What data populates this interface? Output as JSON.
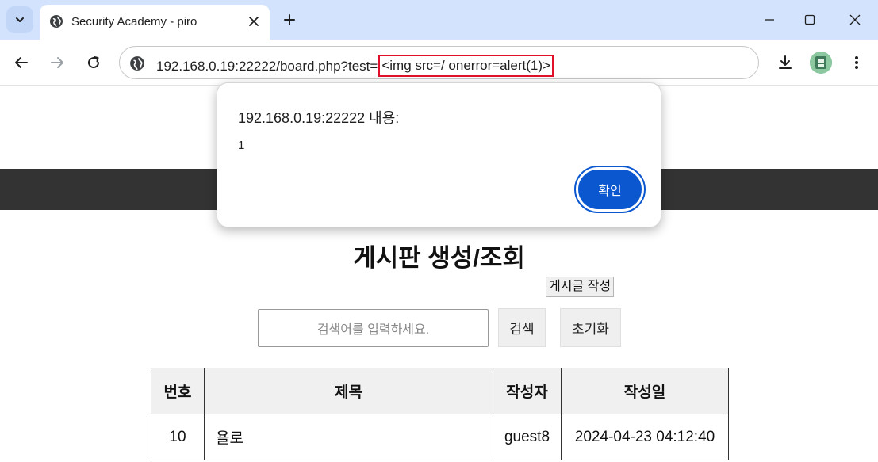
{
  "browser": {
    "tab_title": "Security Academy - piro",
    "url_prefix": "192.168.0.19:22222/board.php?test=",
    "url_highlighted": "<img src=/ onerror=alert(1)>",
    "colors": {
      "tabstrip": "#d3e3fd",
      "highlight_border": "#e0102a"
    }
  },
  "dialog": {
    "heading": "192.168.0.19:22222 내용:",
    "message": "1",
    "ok_label": "확인",
    "ok_color": "#0b57d0"
  },
  "page": {
    "title": "게시판 생성/조회",
    "write_button": "게시글 작성",
    "search_placeholder": "검색어를 입력하세요.",
    "search_button": "검색",
    "reset_button": "초기화"
  },
  "table": {
    "headers": [
      "번호",
      "제목",
      "작성자",
      "작성일"
    ],
    "rows": [
      [
        "10",
        "욜로",
        "guest8",
        "2024-04-23 04:12:40"
      ]
    ]
  }
}
